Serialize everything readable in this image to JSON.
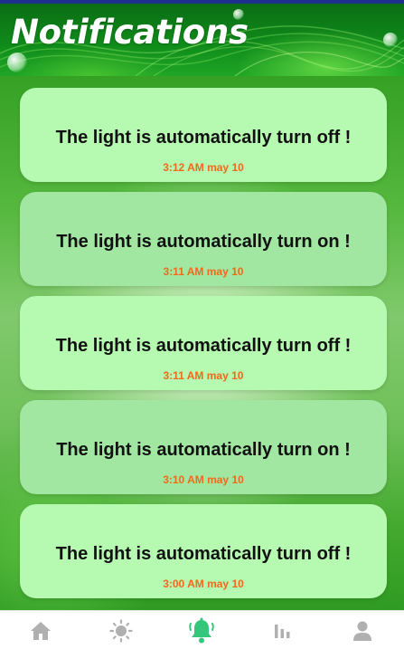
{
  "header": {
    "title": "Notifications"
  },
  "notifications": [
    {
      "message": "The light is automatically turn off !",
      "time": "3:12 AM may 10"
    },
    {
      "message": "The light is automatically turn on !",
      "time": "3:11 AM may 10"
    },
    {
      "message": "The light is automatically turn off !",
      "time": "3:11 AM may 10"
    },
    {
      "message": "The light is automatically turn on !",
      "time": "3:10 AM may 10"
    },
    {
      "message": "The light is automatically turn off !",
      "time": "3:00 AM may 10"
    }
  ],
  "bottom_nav": {
    "items": [
      {
        "icon": "home-icon",
        "active": false
      },
      {
        "icon": "sun-icon",
        "active": false
      },
      {
        "icon": "bell-icon",
        "active": true
      },
      {
        "icon": "bar-chart-icon",
        "active": false
      },
      {
        "icon": "user-icon",
        "active": false
      }
    ]
  },
  "colors": {
    "header_green": "#0f8a1a",
    "card_light": "#b6f9b0",
    "card_dark": "#a1e7a1",
    "timestamp_orange": "#f06a1b",
    "nav_active": "#34c77b",
    "nav_inactive": "#b0b0b0"
  }
}
